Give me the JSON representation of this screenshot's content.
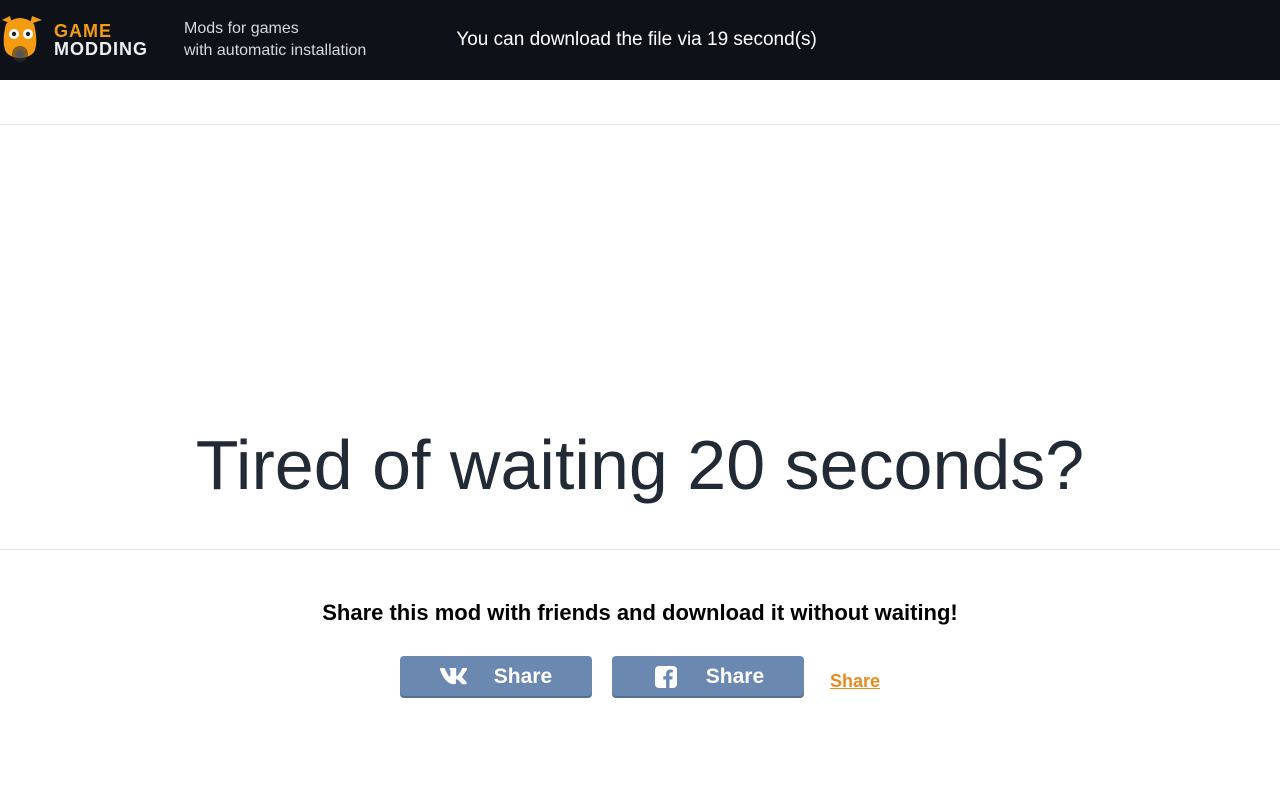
{
  "header": {
    "logo": {
      "line1": "GAME",
      "line2": "MODDING"
    },
    "tagline_line1": "Mods for games",
    "tagline_line2": "with automatic installation",
    "countdown_text": "You can download the file via 19 second(s)"
  },
  "main": {
    "hero_text": "Tired of waiting 20 seconds?"
  },
  "share": {
    "title": "Share this mod with friends and download it without waiting!",
    "vk_label": "Share",
    "fb_label": "Share",
    "text_link": "Share"
  }
}
